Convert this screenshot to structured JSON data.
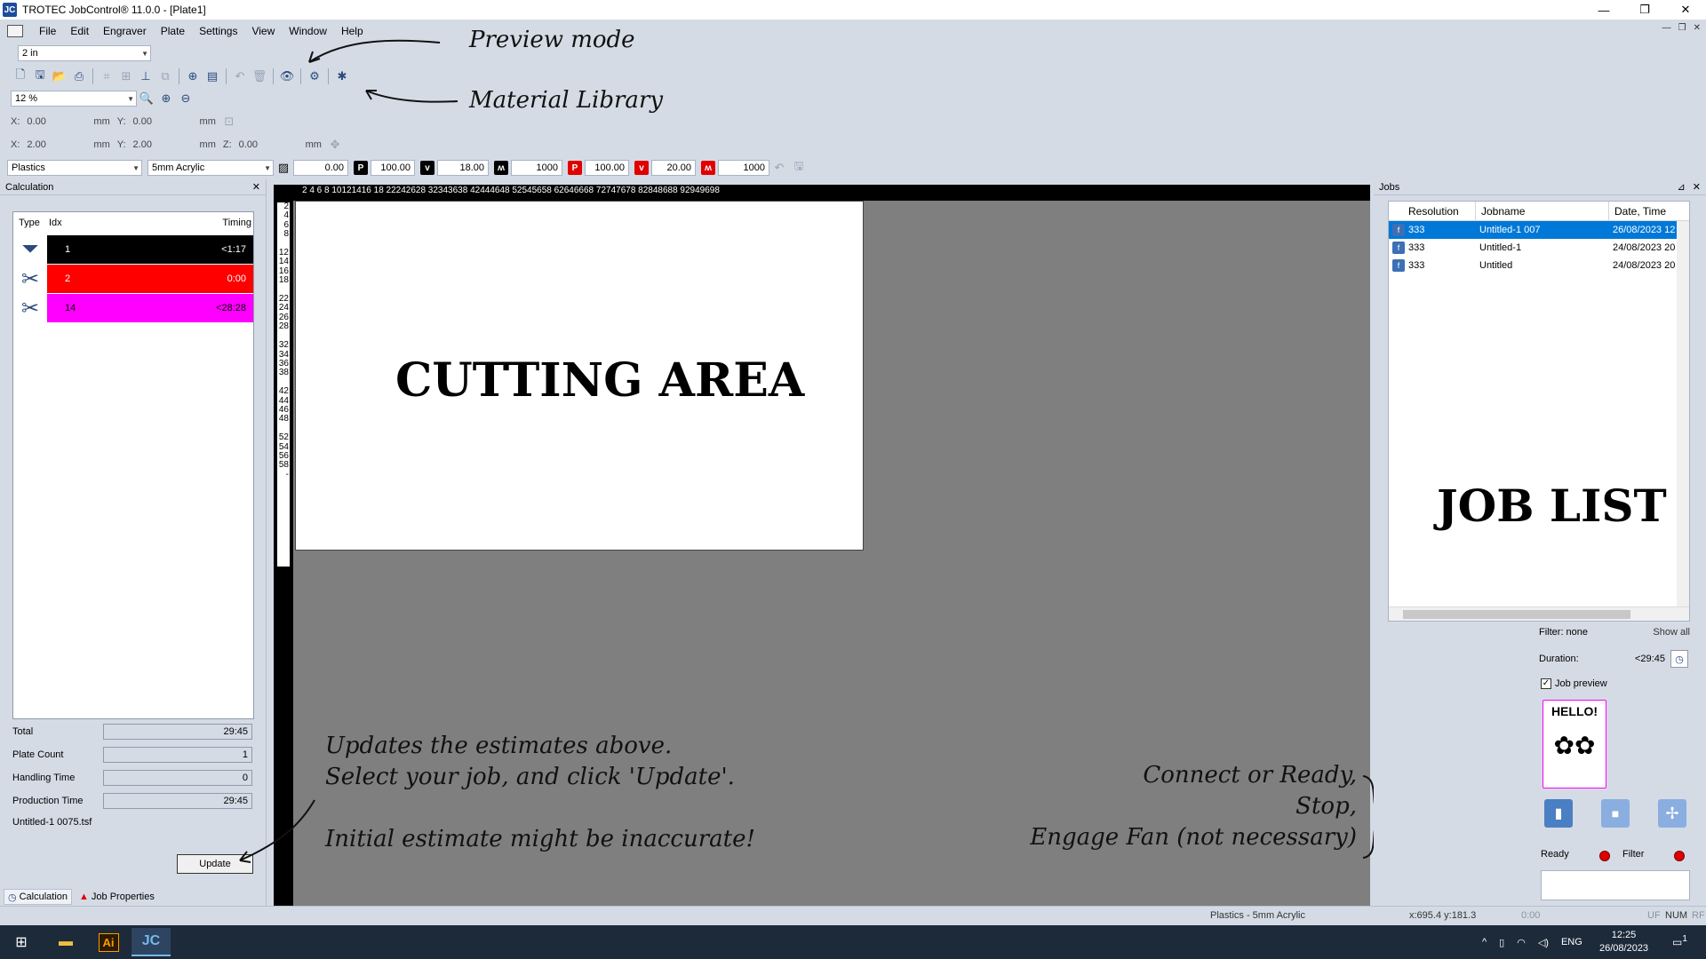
{
  "window": {
    "title": "TROTEC JobControl® 11.0.0 - [Plate1]",
    "app_icon": "JC"
  },
  "menu": [
    "File",
    "Edit",
    "Engraver",
    "Plate",
    "Settings",
    "View",
    "Window",
    "Help"
  ],
  "toolbar": {
    "unit_select": "2 in",
    "zoom_select": "12 %"
  },
  "position": {
    "x_label": "X:",
    "y_label": "Y:",
    "z_label": "Z:",
    "x1": "0.00",
    "y1": "0.00",
    "x2": "2.00",
    "y2": "2.00",
    "z": "0.00",
    "unit": "mm"
  },
  "material": {
    "category": "Plastics",
    "name": "5mm Acrylic",
    "hatch_value": "0.00",
    "p1": "100.00",
    "v1": "18.00",
    "f1": "1000",
    "p2": "100.00",
    "v2": "20.00",
    "f2": "1000"
  },
  "calc_panel": {
    "title": "Calculation",
    "col_type": "Type",
    "col_idx": "Idx",
    "col_timing": "Timing",
    "rows": [
      {
        "idx": "1",
        "timing": "<1:17",
        "color": "#000000",
        "text_color": "#ffffff",
        "icon": "engrave-icon"
      },
      {
        "idx": "2",
        "timing": "0:00",
        "color": "#ff0000",
        "text_color": "#ffffff",
        "icon": "cut-icon"
      },
      {
        "idx": "14",
        "timing": "<28:28",
        "color": "#ff00ff",
        "text_color": "#000000",
        "icon": "cut-icon"
      }
    ],
    "total_label": "Total",
    "total": "29:45",
    "plate_count_label": "Plate Count",
    "plate_count": "1",
    "handling_label": "Handling Time",
    "handling": "0",
    "production_label": "Production Time",
    "production": "29:45",
    "filename": "Untitled-1 0075.tsf",
    "update_button": "Update",
    "tab_calc": "Calculation",
    "tab_props": "Job Properties"
  },
  "ruler": {
    "top": "2 4 6 8 10121416 18    22242628    32343638    42444648    52545658    62646668    72747678    82848688    92949698",
    "left": [
      "2",
      "4",
      "6",
      "8",
      "",
      "12",
      "14",
      "16",
      "18",
      "",
      "22",
      "24",
      "26",
      "28",
      "",
      "32",
      "34",
      "36",
      "38",
      "",
      "42",
      "44",
      "46",
      "48",
      "",
      "52",
      "54",
      "56",
      "58",
      "-"
    ]
  },
  "jobs_panel": {
    "title": "Jobs",
    "col_resolution": "Resolution",
    "col_jobname": "Jobname",
    "col_date": "Date, Time",
    "jobs": [
      {
        "res": "333",
        "name": "Untitled-1 007",
        "date": "26/08/2023 12"
      },
      {
        "res": "333",
        "name": "Untitled-1",
        "date": "24/08/2023 20"
      },
      {
        "res": "333",
        "name": "Untitled",
        "date": "24/08/2023 20"
      }
    ],
    "filter": "Filter: none",
    "show_all": "Show all",
    "duration_label": "Duration:",
    "duration": "<29:45",
    "job_preview_label": "Job preview",
    "preview_text": "HELLO!",
    "ready_label": "Ready",
    "filter_label": "Filter"
  },
  "annotations": {
    "preview_mode": "Preview mode",
    "material_library": "Material Library",
    "cutting_area": "CUTTING AREA",
    "job_list": "JOB LIST",
    "update_line1": "Updates the estimates above.",
    "update_line2": "Select your job, and click 'Update'.",
    "inaccurate": "Initial estimate might be inaccurate!",
    "connect1": "Connect or Ready,",
    "connect2": "Stop,",
    "connect3": "Engage Fan (not necessary)"
  },
  "status": {
    "material": "Plastics - 5mm Acrylic",
    "coords": "x:695.4   y:181.3",
    "time": "0:00",
    "uf": "UF",
    "num": "NUM",
    "rf": "RF"
  },
  "taskbar": {
    "lang": "ENG",
    "time": "12:25",
    "date": "26/08/2023",
    "notif": "1"
  }
}
